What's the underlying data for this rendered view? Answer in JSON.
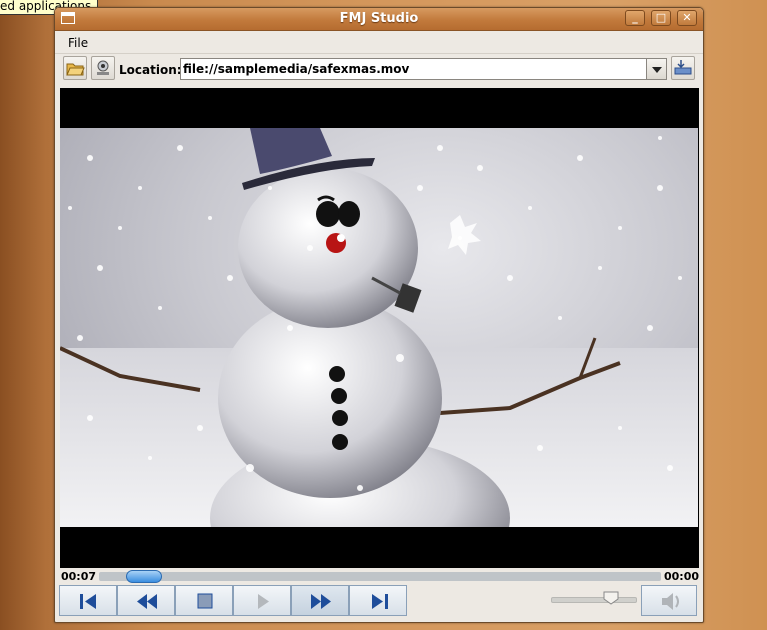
{
  "tooltip": {
    "text": "ed applications"
  },
  "window": {
    "title": "FMJ Studio",
    "controls": {
      "minimize": "_",
      "maximize": "□",
      "close": "✕"
    }
  },
  "menu": {
    "items": [
      "File"
    ]
  },
  "toolbar": {
    "open_icon": "folder-open-icon",
    "capture_icon": "webcam-icon",
    "location_label": "Location:",
    "location_value": "file://samplemedia/safexmas.mov",
    "go_icon": "load-url-icon"
  },
  "playback": {
    "elapsed": "00:07",
    "duration": "00:00",
    "position_fraction": 0.06
  },
  "controls": {
    "buttons": [
      "step-back-icon",
      "rewind-icon",
      "stop-icon",
      "play-icon",
      "fast-forward-icon",
      "step-forward-icon"
    ],
    "volume_level": 0.72,
    "mute_icon": "speaker-icon"
  }
}
